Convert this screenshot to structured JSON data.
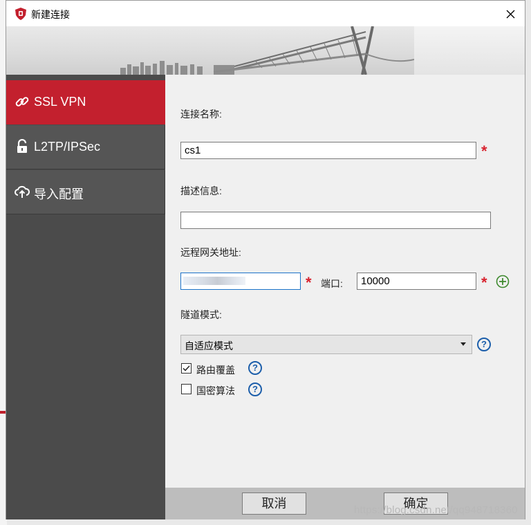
{
  "window": {
    "title": "新建连接",
    "close_glyph": "✕"
  },
  "sidebar": {
    "items": [
      {
        "label": "SSL VPN",
        "icon": "link-icon",
        "active": true
      },
      {
        "label": "L2TP/IPSec",
        "icon": "unlock-icon",
        "active": false
      },
      {
        "label": "导入配置",
        "icon": "cloud-upload-icon",
        "active": false
      }
    ]
  },
  "form": {
    "connection_name_label": "连接名称:",
    "connection_name_value": "cs1",
    "description_label": "描述信息:",
    "description_value": "",
    "gateway_label": "远程网关地址:",
    "gateway_value": "",
    "port_label": "端口:",
    "port_value": "10000",
    "required_mark": "*",
    "tunnel_mode_label": "隧道模式:",
    "tunnel_mode_value": "自适应模式",
    "route_override_label": "路由覆盖",
    "route_override_checked": true,
    "national_crypto_label": "国密算法",
    "national_crypto_checked": false,
    "help_glyph": "?"
  },
  "footer": {
    "cancel_label": "取消",
    "ok_label": "确定"
  },
  "watermark": "https://blog.csdn.net/qq948718360",
  "colors": {
    "accent_red": "#c3202e",
    "sidebar_bg": "#4b4b4b",
    "help_blue": "#1d5fab",
    "add_green": "#3f8a2f",
    "required_red": "#d8222e"
  }
}
